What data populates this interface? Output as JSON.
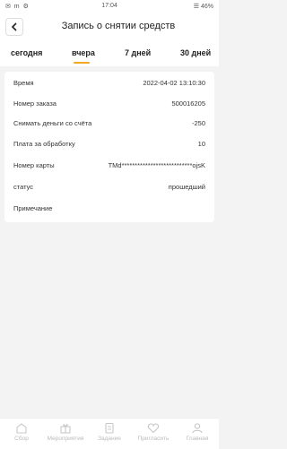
{
  "status_bar": {
    "left_icons": "✉ m ⚙",
    "time": "17:04",
    "right": "☰ 46%"
  },
  "header": {
    "title": "Запись о снятии средств"
  },
  "tabs": [
    {
      "label": "сегодня",
      "active": false
    },
    {
      "label": "вчера",
      "active": true
    },
    {
      "label": "7 дней",
      "active": false
    },
    {
      "label": "30 дней",
      "active": false
    }
  ],
  "accent_color": "#f5a623",
  "record": {
    "rows": [
      {
        "label": "Время",
        "value": "2022-04-02 13:10:30"
      },
      {
        "label": "Номер заказа",
        "value": "500016205"
      },
      {
        "label": "Снимать деньги со счёта",
        "value": "-250"
      },
      {
        "label": "Плата за обработку",
        "value": "10"
      },
      {
        "label": "Номер карты",
        "value": "TMd***************************ojsK"
      },
      {
        "label": "статус",
        "value": "прошедший"
      },
      {
        "label": "Примечание",
        "value": ""
      }
    ]
  },
  "bottom_nav": [
    {
      "label": "Сбор",
      "icon": "home-icon"
    },
    {
      "label": "Мероприятия",
      "icon": "gift-icon"
    },
    {
      "label": "Задание",
      "icon": "task-icon"
    },
    {
      "label": "Пригласить",
      "icon": "heart-icon"
    },
    {
      "label": "Главная",
      "icon": "user-icon"
    }
  ]
}
